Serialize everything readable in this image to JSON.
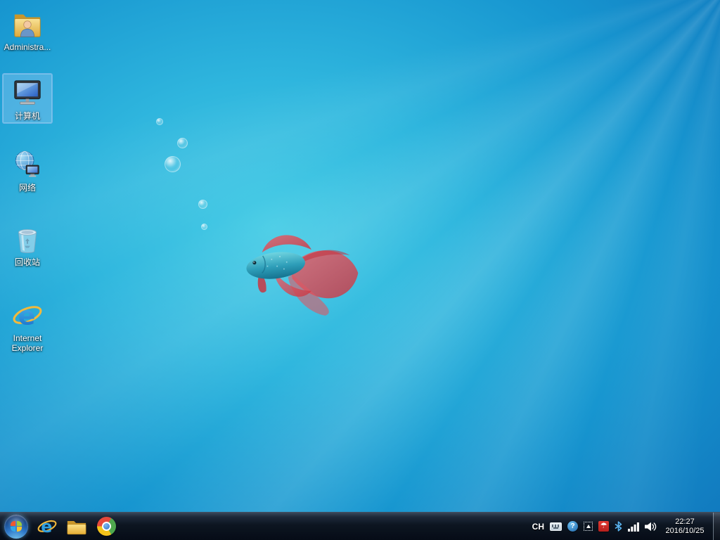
{
  "wallpaper": {
    "center_color": "#49cde6",
    "edge_color": "#0f72ba",
    "fish_body_color": "#2d9db8",
    "fish_fin_color": "#d84752"
  },
  "desktop_icons": [
    {
      "label": "Administra...",
      "icon": "user-folder-icon",
      "selected": false
    },
    {
      "label": "计算机",
      "icon": "computer-icon",
      "selected": true
    },
    {
      "label": "网络",
      "icon": "network-icon",
      "selected": false
    },
    {
      "label": "回收站",
      "icon": "recycle-bin-icon",
      "selected": false
    },
    {
      "label": "Internet Explorer",
      "icon": "internet-explorer-icon",
      "selected": false
    }
  ],
  "taskbar": {
    "start_button_icon": "windows-orb-icon",
    "pinned_buttons": [
      {
        "icon": "internet-explorer-icon"
      },
      {
        "icon": "windows-explorer-folder-icon"
      },
      {
        "icon": "chrome-icon"
      }
    ],
    "tray": {
      "language_indicator": "CH",
      "help_badge_glyph": "?",
      "avira_glyph": "☂",
      "icons": [
        "keyboard-icon",
        "help-icon",
        "hidden-icons-icon",
        "avira-icon",
        "bluetooth-icon",
        "signal-bars-icon",
        "volume-icon"
      ],
      "clock": {
        "time": "22:27",
        "date": "2016/10/25"
      }
    }
  }
}
